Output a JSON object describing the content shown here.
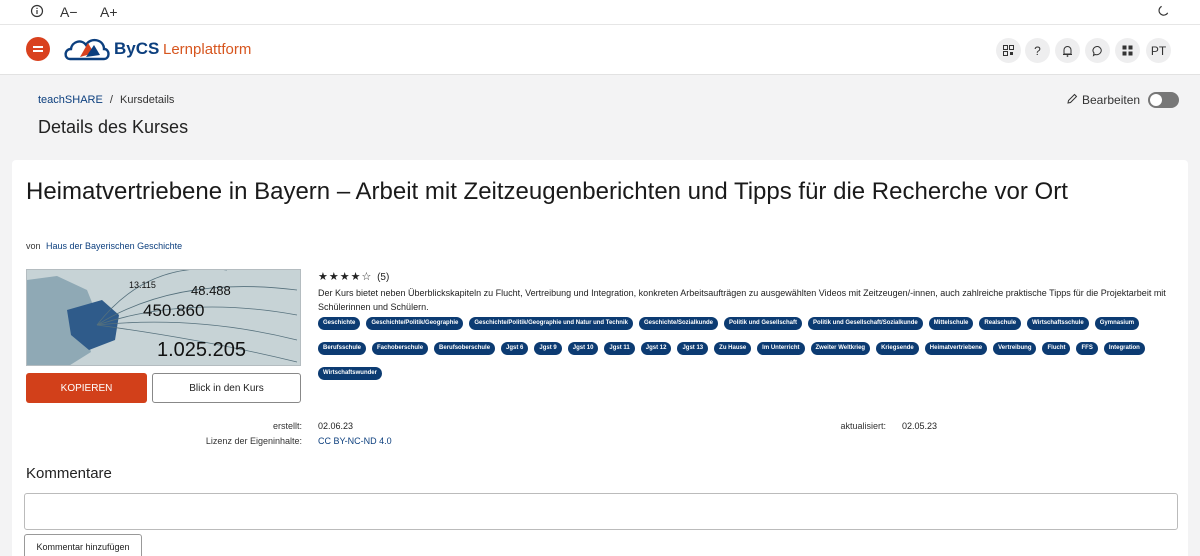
{
  "topbar": {
    "info_icon": "info-icon",
    "font_smaller": "A−",
    "font_larger": "A+",
    "theme_icon": "moon-icon"
  },
  "header": {
    "logo_text": "ByCS",
    "logo_sub": "Lernplattform",
    "icons": [
      "qr-code-icon",
      "help-icon",
      "bell-icon",
      "chat-icon",
      "apps-icon"
    ],
    "avatar": "PT",
    "brand_color": "#d9411e",
    "navy": "#0c3f7e"
  },
  "breadcrumb": {
    "root": "teachSHARE",
    "sep": "/",
    "current": "Kursdetails"
  },
  "page": {
    "title": "Details des Kurses",
    "edit_label": "Bearbeiten",
    "edit_toggle_on": false
  },
  "course": {
    "title": "Heimatvertriebene in Bayern – Arbeit mit Zeitzeugenberichten und Tipps für die Recherche vor Ort",
    "by_prefix": "von",
    "author": "Haus der Bayerischen Geschichte",
    "rating_stars": "★★★★☆",
    "rating_count": "(5)",
    "description": "Der Kurs bietet neben Überblickskapiteln zu Flucht, Vertreibung und Integration, konkreten Arbeitsaufträgen zu ausgewählten Videos mit Zeitzeugen/-innen, auch zahlreiche praktische Tipps für die Projektarbeit mit Schülerinnen und Schülern.",
    "thumbnail": {
      "stat1": "13.115",
      "stat2": "48.488",
      "stat3": "450.860",
      "stat4": "1.025.205"
    },
    "copy_button": "KOPIEREN",
    "view_button": "Blick in den Kurs",
    "tags": [
      "Geschichte",
      "Geschichte/Politik/Geographie",
      "Geschichte/Politik/Geographie und Natur und Technik",
      "Geschichte/Sozialkunde",
      "Politik und Gesellschaft",
      "Politik und Gesellschaft/Sozialkunde",
      "Mittelschule",
      "Realschule",
      "Wirtschaftsschule",
      "Gymnasium",
      "Berufsschule",
      "Fachoberschule",
      "Berufsoberschule",
      "Jgst 6",
      "Jgst 9",
      "Jgst 10",
      "Jgst 11",
      "Jgst 12",
      "Jgst 13",
      "Zu Hause",
      "Im Unterricht",
      "Zweiter Weltkrieg",
      "Kriegsende",
      "Heimatvertriebene",
      "Vertreibung",
      "Flucht",
      "FFS",
      "Integration",
      "Wirtschaftswunder"
    ],
    "created_label": "erstellt:",
    "created_value": "02.06.23",
    "updated_label": "aktualisiert:",
    "updated_value": "02.05.23",
    "license_label": "Lizenz der Eigeninhalte:",
    "license_value": "CC BY-NC-ND 4.0"
  },
  "comments": {
    "title": "Kommentare",
    "button": "Kommentar hinzufügen"
  }
}
